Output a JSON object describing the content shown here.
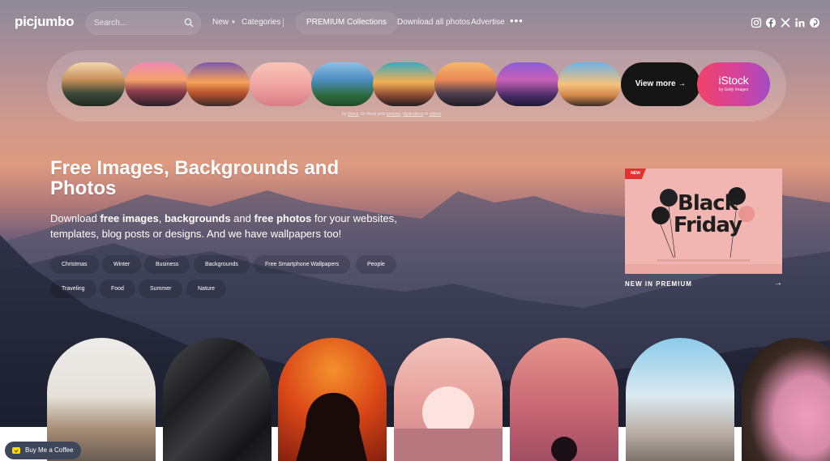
{
  "header": {
    "logo": "picjumbo",
    "search_placeholder": "Search...",
    "nav": {
      "new": "New",
      "categories": "Categories",
      "premium": "PREMIUM Collections",
      "download_all": "Download all photos",
      "advertise": "Advertise"
    },
    "more_icon": "more-horizontal-icon",
    "social_icons": [
      "instagram-icon",
      "facebook-icon",
      "x-icon",
      "linkedin-icon",
      "pinterest-icon"
    ]
  },
  "collections": {
    "view_more": "View more →",
    "istock": {
      "name": "iStock",
      "sub": "by Getty Images"
    },
    "credit": {
      "prefix": "by ",
      "brand": "iStock",
      "middle": ", for those pros ",
      "link1": "pictures",
      "sep": ", ",
      "link2": "illustrations",
      "or": " or ",
      "link3": "videos"
    }
  },
  "hero": {
    "title": "Free Images, Backgrounds and Photos",
    "desc": {
      "p1": "Download ",
      "b1": "free images",
      "p2": ", ",
      "b2": "backgrounds",
      "p3": " and ",
      "b3": "free photos",
      "p4": " for your websites, templates, blog posts or designs. And we have wallpapers too!"
    },
    "tags": [
      "Christmas",
      "Winter",
      "Business",
      "Backgrounds",
      "Free Smartphone Wallpapers",
      "People",
      "Traveling",
      "Food",
      "Summer",
      "Nature"
    ]
  },
  "premium_card": {
    "badge": "NEW",
    "image_text": "Black Friday",
    "label": "NEW IN PREMIUM",
    "arrow": "→"
  },
  "buy_coffee": "Buy Me a Coffee",
  "colors": {
    "view_more_bg": "#151515",
    "istock_gradient_start": "#f2426a",
    "istock_gradient_end": "#a34bc6",
    "new_badge": "#e2312f",
    "coffee_button_bg": "#3e465a"
  }
}
